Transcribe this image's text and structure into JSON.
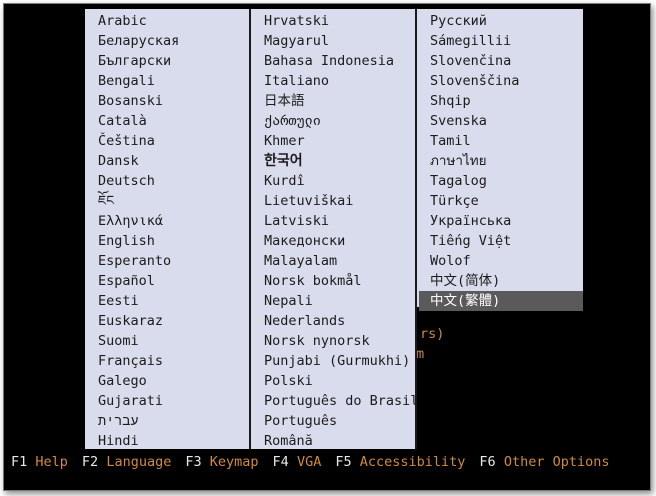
{
  "columns": [
    [
      "Arabic",
      "Беларуская",
      "Български",
      "Bengali",
      "Bosanski",
      "Català",
      "Čeština",
      "Dansk",
      "Deutsch",
      "ཇོང",
      "Ελληνικά",
      "English",
      "Esperanto",
      "Español",
      "Eesti",
      "Euskaraz",
      "Suomi",
      "Français",
      "Galego",
      "Gujarati",
      "עברית",
      "Hindi"
    ],
    [
      "Hrvatski",
      "Magyarul",
      "Bahasa Indonesia",
      "Italiano",
      "日本語",
      "ქართული",
      "Khmer",
      "한국어",
      "Kurdî",
      "Lietuviškai",
      "Latviski",
      "Македонски",
      "Malayalam",
      "Norsk bokmål",
      "Nepali",
      "Nederlands",
      "Norsk nynorsk",
      "Punjabi (Gurmukhi)",
      "Polski",
      "Português do Brasil",
      "Português",
      "Română"
    ],
    [
      "Русский",
      "Sámegillii",
      "Slovenčina",
      "Slovenščina",
      "Shqip",
      "Svenska",
      "Tamil",
      "ภาษาไทย",
      "Tagalog",
      "Türkçe",
      "Українська",
      "Tiếng Việt",
      "Wolof",
      "中文(简体)",
      "中文(繁體)"
    ]
  ],
  "selected": "中文(繁體)",
  "background_fragments": [
    "rs)",
    "m"
  ],
  "fkeys": [
    {
      "key": "F1",
      "label": "Help"
    },
    {
      "key": "F2",
      "label": "Language"
    },
    {
      "key": "F3",
      "label": "Keymap"
    },
    {
      "key": "F4",
      "label": "VGA"
    },
    {
      "key": "F5",
      "label": "Accessibility"
    },
    {
      "key": "F6",
      "label": "Other Options"
    }
  ],
  "colors": {
    "menu_bg": "#d8dcec",
    "selected_bg": "#5a5a5a",
    "fkey_label": "#d08a3a",
    "background": "#000000"
  }
}
